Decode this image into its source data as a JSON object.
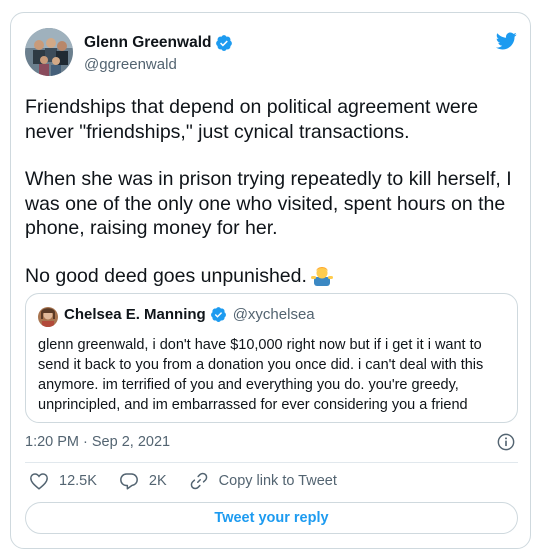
{
  "author": {
    "name": "Glenn Greenwald",
    "handle": "@ggreenwald",
    "verified": true
  },
  "tweet": {
    "paragraph1": "Friendships that depend on political agreement were never \"friendships,\" just cynical transactions.",
    "paragraph2": "When she was in prison trying repeatedly to kill herself, I was one of the only one who visited, spent hours on the phone, raising money for her.",
    "paragraph3": "No good deed goes unpunished."
  },
  "quoted": {
    "name": "Chelsea E. Manning",
    "handle": "@xychelsea",
    "verified": true,
    "text": "glenn greenwald, i don't have $10,000 right now but if i get it i want to send it back to you from a donation you once did. i can't deal with this anymore. im terrified of you and everything you do. you're greedy, unprincipled, and im embarrassed for ever considering you a friend"
  },
  "timestamp": "1:20 PM · Sep 2, 2021",
  "actions": {
    "likes": "12.5K",
    "replies": "2K",
    "copy_link": "Copy link to Tweet"
  },
  "reply_button": "Tweet your reply",
  "colors": {
    "brand_blue": "#1d9bf0",
    "like_red": "#f91880",
    "text_primary": "#0f1419",
    "text_secondary": "#536471",
    "border": "#cfd9de"
  },
  "icons": [
    "verified-icon",
    "twitter-bird-icon",
    "man-shrugging-emoji",
    "info-icon",
    "heart-icon",
    "reply-icon",
    "link-icon"
  ]
}
